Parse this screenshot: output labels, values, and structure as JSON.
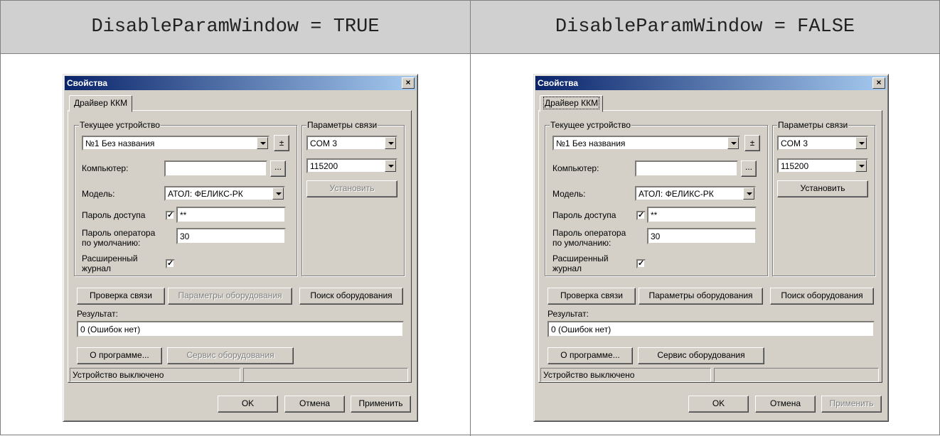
{
  "headers": {
    "left": "DisableParamWindow = TRUE",
    "right": "DisableParamWindow = FALSE"
  },
  "dialog": {
    "title": "Свойства",
    "close_glyph": "×",
    "tab": "Драйвер ККМ",
    "device_group": "Текущее устройство",
    "device_value": "№1 Без названия",
    "add_remove_glyph": "±",
    "computer_label": "Компьютер:",
    "computer_value": "",
    "browse_glyph": "...",
    "model_label": "Модель:",
    "model_value": "АТОЛ: ФЕЛИКС-РК",
    "password_label": "Пароль доступа",
    "password_value": "**",
    "operator_label_1": "Пароль оператора",
    "operator_label_2": "по умолчанию:",
    "operator_value": "30",
    "journal_label_1": "Расширенный",
    "journal_label_2": "журнал",
    "check_mark": "✓",
    "conn_group": "Параметры связи",
    "port_value": "COM 3",
    "baud_value": "115200",
    "install_label": "Установить",
    "check_conn_label": "Проверка связи",
    "equip_params_label": "Параметры оборудования",
    "search_equip_label": "Поиск оборудования",
    "result_label": "Результат:",
    "result_value": "0 (Ошибок нет)",
    "about_label": "О программе...",
    "service_label": "Сервис оборудования",
    "status_text": "Устройство выключено",
    "ok_label": "OK",
    "cancel_label": "Отмена",
    "apply_label": "Применить"
  },
  "colors": {
    "title_start": "#0a246a",
    "title_end": "#a6caf0",
    "face": "#d4d0c8",
    "header_bg": "#d0d0d0"
  }
}
